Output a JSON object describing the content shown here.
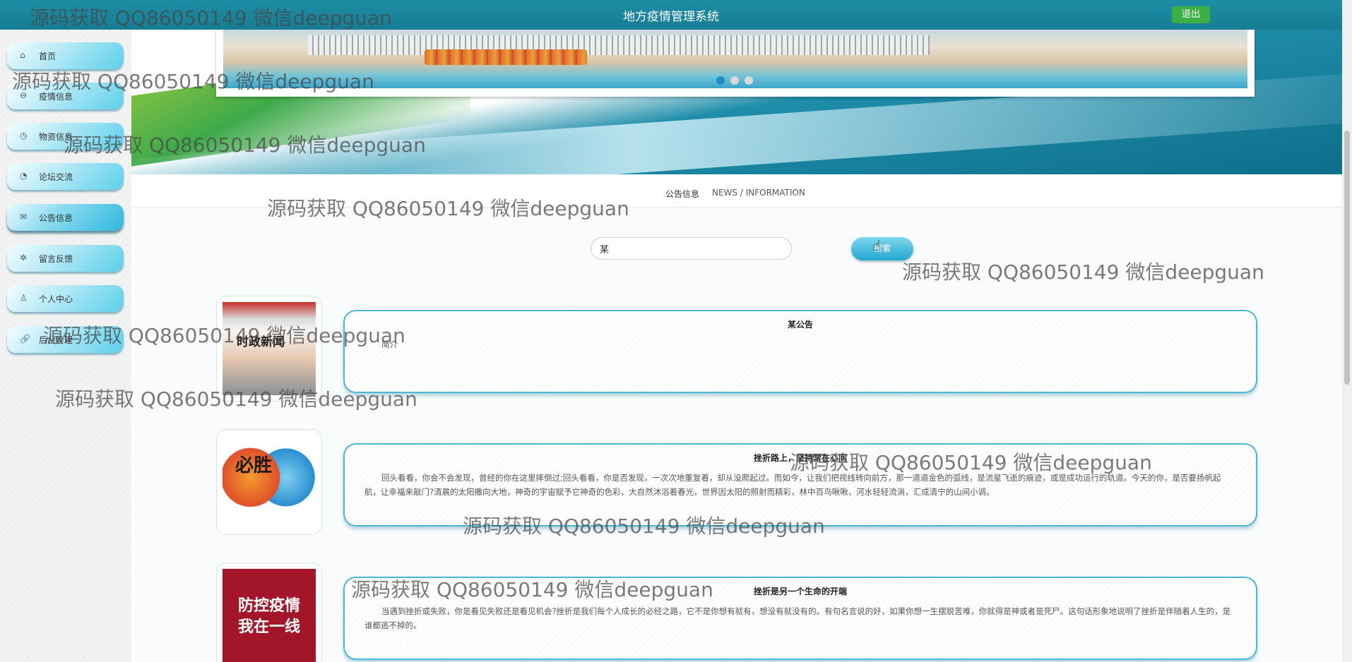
{
  "app": {
    "title": "地方疫情管理系统",
    "logout_label": "退出"
  },
  "sidebar": {
    "items": [
      {
        "label": "首页",
        "icon": "⌂",
        "icon_name": "home-icon"
      },
      {
        "label": "疫情信息",
        "icon": "⊖",
        "icon_name": "epidemic-icon"
      },
      {
        "label": "物资信息",
        "icon": "◷",
        "icon_name": "gauge-icon"
      },
      {
        "label": "论坛交流",
        "icon": "◔",
        "icon_name": "forum-icon"
      },
      {
        "label": "公告信息",
        "icon": "✉",
        "icon_name": "mail-icon"
      },
      {
        "label": "留言反馈",
        "icon": "✲",
        "icon_name": "feedback-icon"
      },
      {
        "label": "个人中心",
        "icon": "♙",
        "icon_name": "user-icon"
      },
      {
        "label": "后台管理",
        "icon": "🔗",
        "icon_name": "link-icon"
      }
    ]
  },
  "section": {
    "title_cn": "公告信息",
    "title_en": "NEWS / INFORMATION"
  },
  "search": {
    "value": "某",
    "button_label": "搜索"
  },
  "notices": [
    {
      "title": "某公告",
      "body": "简介",
      "thumb_text": "时政新闻"
    },
    {
      "title": "挫折路上，坚持常在心间",
      "body": "回头看看，你会不会发现，曾经的你在这里摔倒过;回头看看，你是否发现，一次次地重复着，却从没爬起过。而如今，让我们把视线转向前方，那一道道金色的弧线，是流星飞逝的痕迹，或是成功运行的轨道。今天的你，是否要扬帆起航，让幸福来敲门?清晨的太阳撒向大地，神奇的宇宙赋予它神奇的色彩，大自然沐浴着春光，世界因太阳的照射而精彩，林中百鸟啾啾，河水轻轻流淌，汇成清宁的山间小调。",
      "thumb_text": "必胜"
    },
    {
      "title": "挫折是另一个生命的开端",
      "body": "当遇到挫折或失败，你是看见失败还是看见机会?挫折是我们每个人成长的必经之路，它不是你想有就有，想没有就没有的。有句名言说的好，如果你想一生摆脱苦难，你就得是神或者是死尸。这句话形象地说明了挫折是伴随着人生的，是谁都逃不掉的。",
      "thumb_text": "防控疫情我在一线"
    }
  ],
  "watermark": "源码获取 QQ86050149 微信deepguan",
  "colors": {
    "topbar": "#1d8ea5",
    "logout": "#3cb043",
    "card_border": "#47b8d6",
    "accent": "#21a6cf"
  }
}
